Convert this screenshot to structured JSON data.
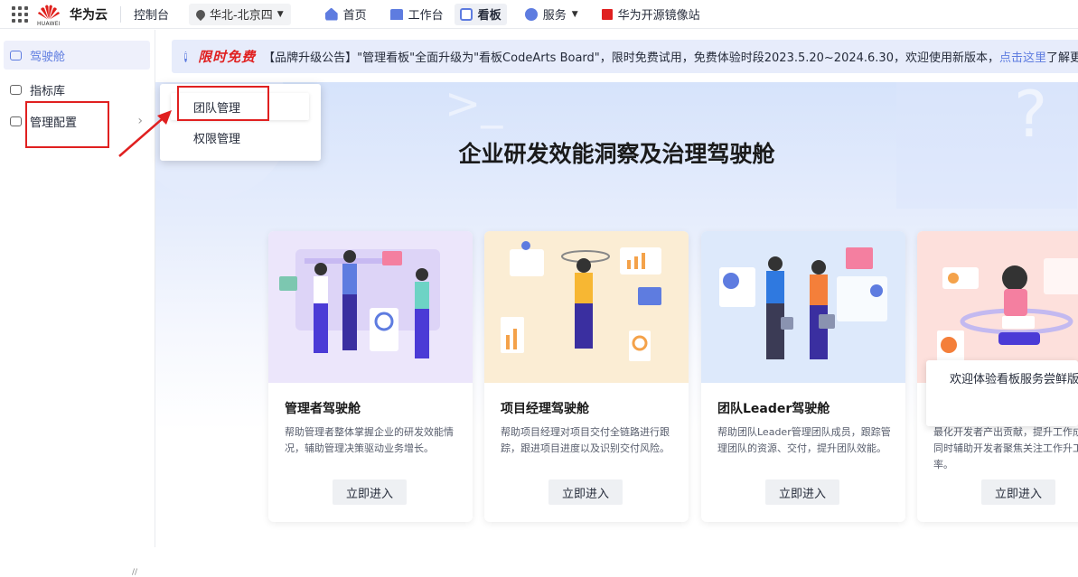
{
  "topbar": {
    "logo_caption": "HUAWEI",
    "brand": "华为云",
    "console": "控制台",
    "region": "华北-北京四",
    "nav": [
      {
        "label": "首页",
        "icon": "home-icon"
      },
      {
        "label": "工作台",
        "icon": "workbench-icon"
      },
      {
        "label": "看板",
        "icon": "board-icon",
        "active": true
      },
      {
        "label": "服务",
        "icon": "service-icon"
      },
      {
        "label": "华为开源镜像站",
        "icon": "mirror-icon"
      }
    ]
  },
  "sidebar": {
    "items": [
      {
        "label": "驾驶舱",
        "icon": "car-icon",
        "active": true
      },
      {
        "label": "指标库",
        "icon": "metric-icon"
      },
      {
        "label": "管理配置",
        "icon": "settings-doc-icon"
      }
    ]
  },
  "submenu": {
    "items": [
      {
        "label": "团队管理"
      },
      {
        "label": "权限管理"
      }
    ]
  },
  "notice": {
    "badge": "限时免费",
    "text_before": "【品牌升级公告】\"管理看板\"全面升级为\"看板CodeArts Board\"，限时免费试用，免费体验时段2023.5.20~2024.6.30，欢迎使用新版本，",
    "link": "点击这里",
    "text_after": "了解更多新版"
  },
  "hero": {
    "title": "企业研发效能洞察及治理驾驶舱"
  },
  "cards": [
    {
      "title": "管理者驾驶舱",
      "desc": "帮助管理者整体掌握企业的研发效能情况，辅助管理决策驱动业务增长。",
      "button": "立即进入"
    },
    {
      "title": "项目经理驾驶舱",
      "desc": "帮助项目经理对项目交付全链路进行跟踪，跟进项目进度以及识别交付风险。",
      "button": "立即进入"
    },
    {
      "title": "团队Leader驾驶舱",
      "desc": "帮助团队Leader管理团队成员，跟踪管理团队的资源、交付，提升团队效能。",
      "button": "立即进入"
    },
    {
      "title": "",
      "desc": "最化开发者产出贡献，提升工作成感，同时辅助开发者聚焦关注工作升工作效率。",
      "button": "立即进入"
    }
  ],
  "welcome": {
    "text": "欢迎体验看板服务尝鲜版"
  },
  "colors": {
    "accent": "#5e7ce0",
    "highlight_box": "#e02020"
  }
}
